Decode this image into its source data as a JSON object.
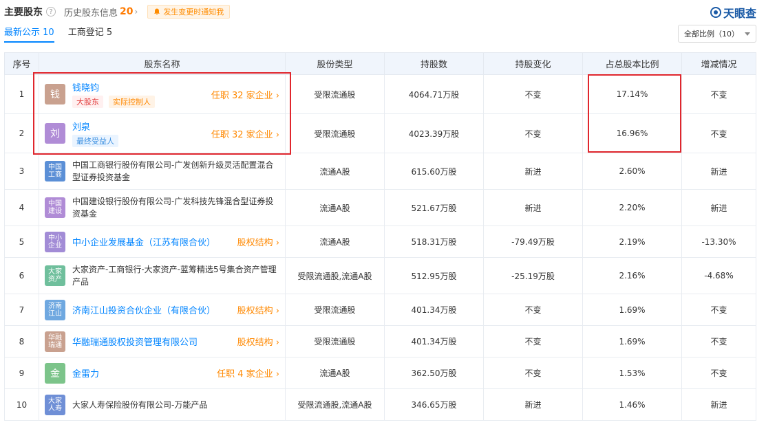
{
  "header": {
    "title": "主要股东",
    "help_glyph": "?",
    "history_label": "历史股东信息",
    "history_count": "20",
    "history_chevron": "›",
    "notify_label": "发生变更时通知我",
    "brand_name": "天眼查"
  },
  "tabs": [
    {
      "label": "最新公示 10"
    },
    {
      "label": "工商登记 5"
    }
  ],
  "filter": {
    "label": "全部比例（10）"
  },
  "table": {
    "columns": [
      "序号",
      "股东名称",
      "股份类型",
      "持股数",
      "持股变化",
      "占总股本比例",
      "增减情况"
    ],
    "rows": [
      {
        "index": "1",
        "logo_text": "钱",
        "logo_color": "#c9a18f",
        "name": "钱晓钧",
        "tags": [
          "大股东",
          "实际控制人"
        ],
        "link": "任职 32 家企业 ›",
        "share_type": "受限流通股",
        "shares": "4064.71万股",
        "change": "不变",
        "ratio": "17.14%",
        "trend": "不变"
      },
      {
        "index": "2",
        "logo_text": "刘",
        "logo_color": "#b08cd6",
        "name": "刘泉",
        "tags": [
          "最终受益人"
        ],
        "link": "任职 32 家企业 ›",
        "share_type": "受限流通股",
        "shares": "4023.39万股",
        "change": "不变",
        "ratio": "16.96%",
        "trend": "不变"
      },
      {
        "index": "3",
        "logo_text": "中国工商",
        "logo_color": "#5b8fd6",
        "name": "中国工商银行股份有限公司-广发创新升级灵活配置混合型证券投资基金",
        "link": "",
        "share_type": "流通A股",
        "shares": "615.60万股",
        "change": "新进",
        "ratio": "2.60%",
        "trend": "新进"
      },
      {
        "index": "4",
        "logo_text": "中国建设",
        "logo_color": "#b08cd6",
        "name": "中国建设银行股份有限公司-广发科技先锋混合型证券投资基金",
        "link": "",
        "share_type": "流通A股",
        "shares": "521.67万股",
        "change": "新进",
        "ratio": "2.20%",
        "trend": "新进"
      },
      {
        "index": "5",
        "logo_text": "中小企业",
        "logo_color": "#a28cd6",
        "name": "中小企业发展基金（江苏有限合伙）",
        "link": "股权结构 ›",
        "share_type": "流通A股",
        "shares": "518.31万股",
        "change": "-79.49万股",
        "ratio": "2.19%",
        "trend": "-13.30%"
      },
      {
        "index": "6",
        "logo_text": "大家资产",
        "logo_color": "#6fbf9c",
        "name": "大家资产-工商银行-大家资产-蓝筹精选5号集合资产管理产品",
        "link": "",
        "share_type": "受限流通股,流通A股",
        "shares": "512.95万股",
        "change": "-25.19万股",
        "ratio": "2.16%",
        "trend": "-4.68%"
      },
      {
        "index": "7",
        "logo_text": "济南江山",
        "logo_color": "#6fa8e0",
        "name": "济南江山投资合伙企业（有限合伙）",
        "link": "股权结构 ›",
        "share_type": "受限流通股",
        "shares": "401.34万股",
        "change": "不变",
        "ratio": "1.69%",
        "trend": "不变"
      },
      {
        "index": "8",
        "logo_text": "华融瑞通",
        "logo_color": "#c9a18f",
        "name": "华融瑞通股权投资管理有限公司",
        "link": "股权结构 ›",
        "share_type": "受限流通股",
        "shares": "401.34万股",
        "change": "不变",
        "ratio": "1.69%",
        "trend": "不变"
      },
      {
        "index": "9",
        "logo_text": "金",
        "logo_color": "#7cc48a",
        "name": "金雷力",
        "link": "任职 4 家企业 ›",
        "share_type": "流通A股",
        "shares": "362.50万股",
        "change": "不变",
        "ratio": "1.53%",
        "trend": "不变"
      },
      {
        "index": "10",
        "logo_text": "大家人寿",
        "logo_color": "#6f8fd6",
        "name": "大家人寿保险股份有限公司-万能产品",
        "link": "",
        "share_type": "受限流通股,流通A股",
        "shares": "346.65万股",
        "change": "新进",
        "ratio": "1.46%",
        "trend": "新进"
      }
    ]
  },
  "colors": {
    "accent": "#0084ff",
    "link_orange": "#ff8800",
    "highlight": "#e0262d",
    "header_bg": "#f0f5fc"
  }
}
